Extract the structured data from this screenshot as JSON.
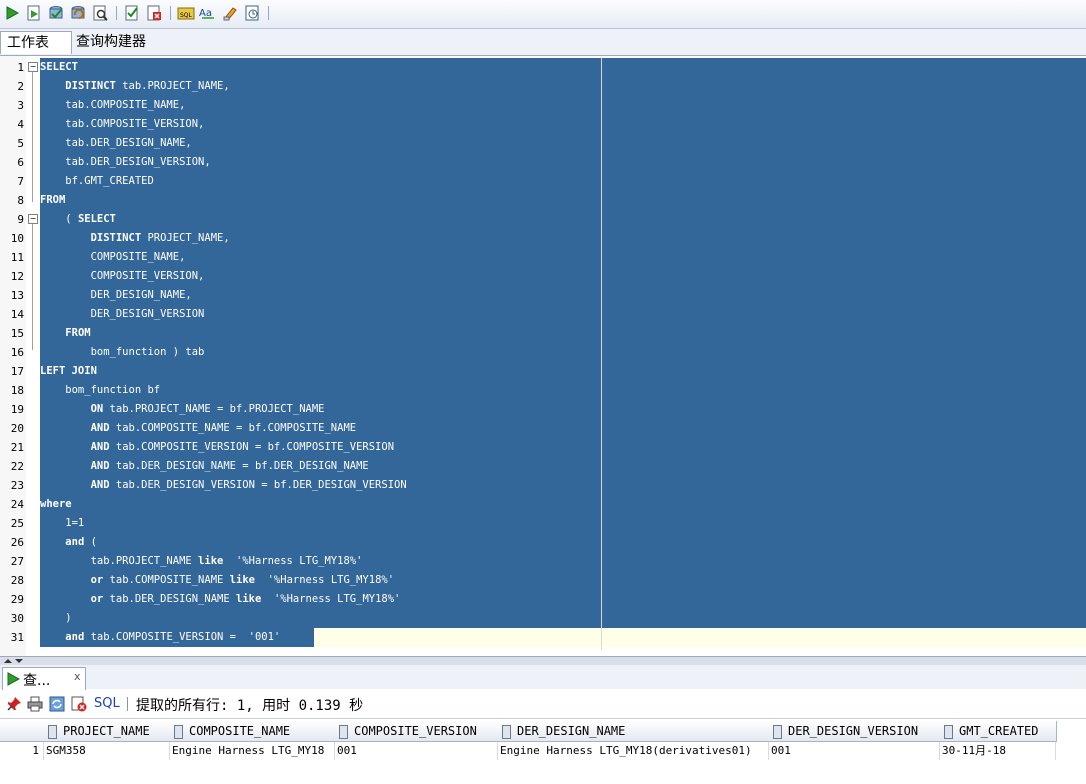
{
  "toolbar": {
    "buttons": [
      "run-statement-icon",
      "run-script-icon",
      "commit-icon",
      "rollback-icon",
      "autotrace-icon",
      "explain-plan-icon",
      "sql-tuning-icon",
      "sql-history-icon",
      "uppercase-icon",
      "clear-icon",
      "history-icon"
    ]
  },
  "tabs": {
    "worksheet": "工作表",
    "query_builder": "查询构建器"
  },
  "editor": {
    "lines": [
      {
        "n": "1",
        "t": "SELECT"
      },
      {
        "n": "2",
        "t": "    DISTINCT tab.PROJECT_NAME,"
      },
      {
        "n": "3",
        "t": "    tab.COMPOSITE_NAME,"
      },
      {
        "n": "4",
        "t": "    tab.COMPOSITE_VERSION,"
      },
      {
        "n": "5",
        "t": "    tab.DER_DESIGN_NAME,"
      },
      {
        "n": "6",
        "t": "    tab.DER_DESIGN_VERSION,"
      },
      {
        "n": "7",
        "t": "    bf.GMT_CREATED"
      },
      {
        "n": "8",
        "t": "FROM"
      },
      {
        "n": "9",
        "t": "    ( SELECT"
      },
      {
        "n": "10",
        "t": "        DISTINCT PROJECT_NAME,"
      },
      {
        "n": "11",
        "t": "        COMPOSITE_NAME,"
      },
      {
        "n": "12",
        "t": "        COMPOSITE_VERSION,"
      },
      {
        "n": "13",
        "t": "        DER_DESIGN_NAME,"
      },
      {
        "n": "14",
        "t": "        DER_DESIGN_VERSION"
      },
      {
        "n": "15",
        "t": "    FROM"
      },
      {
        "n": "16",
        "t": "        bom_function ) tab"
      },
      {
        "n": "17",
        "t": "LEFT JOIN"
      },
      {
        "n": "18",
        "t": "    bom_function bf"
      },
      {
        "n": "19",
        "t": "        ON tab.PROJECT_NAME = bf.PROJECT_NAME"
      },
      {
        "n": "20",
        "t": "        AND tab.COMPOSITE_NAME = bf.COMPOSITE_NAME"
      },
      {
        "n": "21",
        "t": "        AND tab.COMPOSITE_VERSION = bf.COMPOSITE_VERSION"
      },
      {
        "n": "22",
        "t": "        AND tab.DER_DESIGN_NAME = bf.DER_DESIGN_NAME"
      },
      {
        "n": "23",
        "t": "        AND tab.DER_DESIGN_VERSION = bf.DER_DESIGN_VERSION"
      },
      {
        "n": "24",
        "t": "where"
      },
      {
        "n": "25",
        "t": "    1=1"
      },
      {
        "n": "26",
        "t": "    and ("
      },
      {
        "n": "27",
        "t": "        tab.PROJECT_NAME like  '%Harness LTG_MY18%'"
      },
      {
        "n": "28",
        "t": "        or tab.COMPOSITE_NAME like  '%Harness LTG_MY18%'"
      },
      {
        "n": "29",
        "t": "        or tab.DER_DESIGN_NAME like  '%Harness LTG_MY18%'"
      },
      {
        "n": "30",
        "t": "    )"
      },
      {
        "n": "31",
        "t": "    and tab.COMPOSITE_VERSION =  '001'"
      }
    ]
  },
  "results": {
    "tab_label": "查...",
    "tab_close": "x",
    "sql_label": "SQL",
    "status": "提取的所有行: 1, 用时 0.139 秒",
    "columns": [
      "PROJECT_NAME",
      "COMPOSITE_NAME",
      "COMPOSITE_VERSION",
      "DER_DESIGN_NAME",
      "DER_DESIGN_VERSION",
      "GMT_CREATED"
    ],
    "rows": [
      {
        "n": "1",
        "cells": [
          "SGM358",
          "Engine Harness LTG_MY18",
          "001",
          "Engine Harness LTG_MY18(derivatives01)",
          "001",
          "30-11月-18"
        ]
      }
    ]
  },
  "colors": {
    "selection": "#336699",
    "current_line": "#ffffe8",
    "toolbar_bg": "#e6ecf5"
  }
}
